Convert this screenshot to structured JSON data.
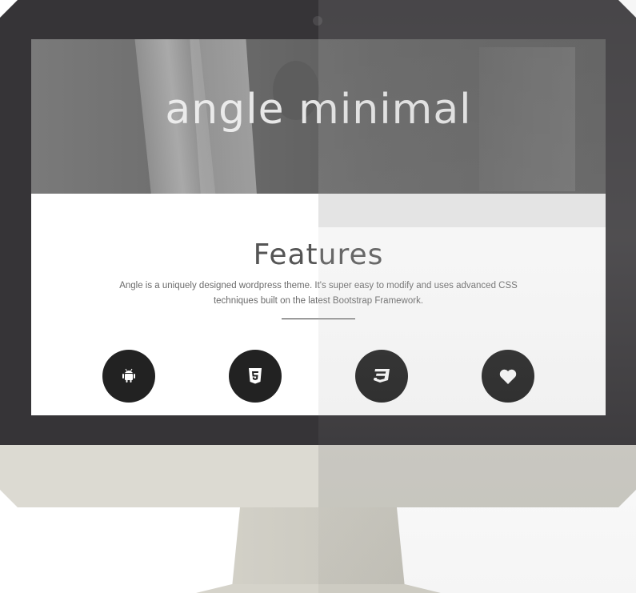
{
  "hero": {
    "title": "angle minimal"
  },
  "features": {
    "title": "Features",
    "description": "Angle is a uniquely designed wordpress theme. It's super easy to modify and uses advanced CSS techniques built on the latest Bootstrap Framework.",
    "icons": [
      {
        "name": "android-icon"
      },
      {
        "name": "html5-icon"
      },
      {
        "name": "css3-icon"
      },
      {
        "name": "heart-icon"
      }
    ]
  },
  "colors": {
    "bezel": "#363437",
    "chin": "#dcdad2",
    "icon_circle": "#222222",
    "hero_text": "#f2f2f2"
  }
}
